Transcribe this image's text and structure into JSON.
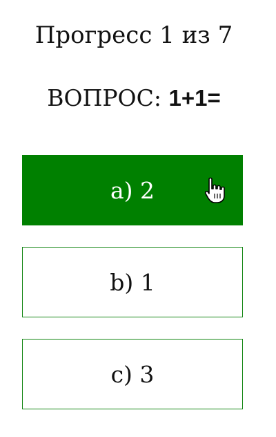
{
  "progress_text": "Прогресс 1 из 7",
  "question": {
    "label": "ВОПРОС: ",
    "text": "1+1="
  },
  "answers": [
    {
      "label": "a) 2",
      "selected": true
    },
    {
      "label": "b) 1",
      "selected": false
    },
    {
      "label": "c) 3",
      "selected": false
    }
  ],
  "colors": {
    "selected_bg": "#008000",
    "border": "#138613"
  },
  "cursor_icon": "hand-pointer-icon"
}
